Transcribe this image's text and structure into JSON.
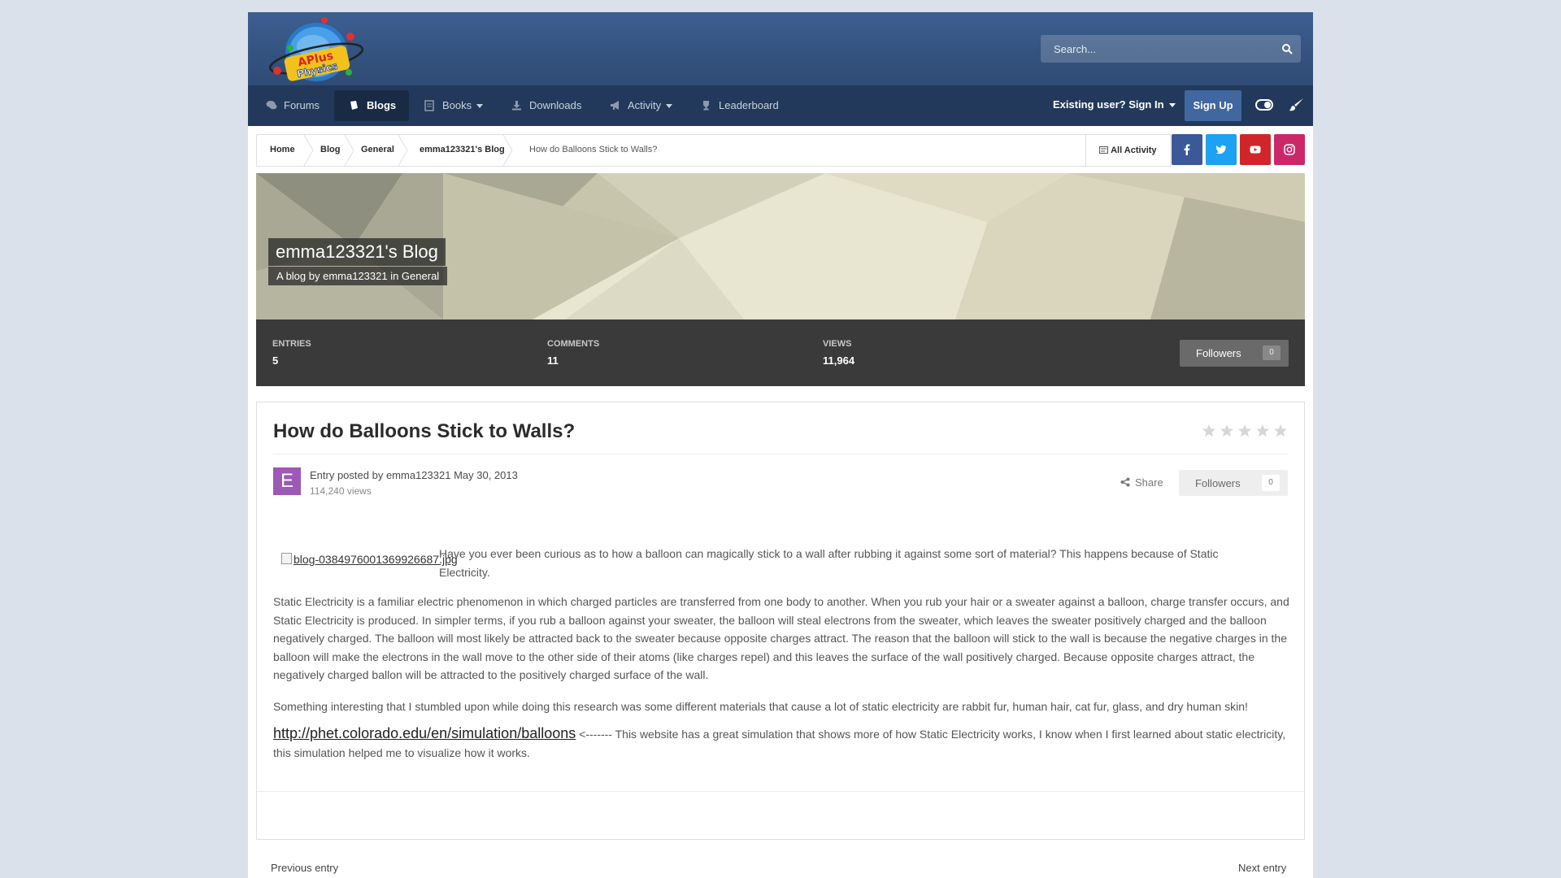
{
  "header": {
    "logo_text": [
      "APlus",
      "Physics"
    ],
    "search_placeholder": "Search..."
  },
  "nav": {
    "items": [
      {
        "label": "Forums",
        "icon": "comments-icon"
      },
      {
        "label": "Blogs",
        "icon": "book-icon",
        "active": true
      },
      {
        "label": "Books",
        "icon": "document-icon",
        "dropdown": true
      },
      {
        "label": "Downloads",
        "icon": "download-icon"
      },
      {
        "label": "Activity",
        "icon": "megaphone-icon",
        "dropdown": true
      },
      {
        "label": "Leaderboard",
        "icon": "trophy-icon"
      }
    ],
    "signin_label": "Existing user? Sign In",
    "signup_label": "Sign Up"
  },
  "breadcrumb": {
    "items": [
      "Home",
      "Blog",
      "General",
      "emma123321's Blog",
      "How do Balloons Stick to Walls?"
    ],
    "all_activity": "All Activity"
  },
  "social": [
    {
      "name": "facebook",
      "color": "#3b5998"
    },
    {
      "name": "twitter",
      "color": "#1da1f2"
    },
    {
      "name": "youtube",
      "color": "#d0262a"
    },
    {
      "name": "instagram",
      "color": "#cb2869"
    }
  ],
  "blog": {
    "title": "emma123321's Blog",
    "subtitle": "A blog by emma123321 in General",
    "stats": [
      {
        "label": "Entries",
        "value": "5"
      },
      {
        "label": "Comments",
        "value": "11"
      },
      {
        "label": "Views",
        "value": "11,964"
      }
    ],
    "followers_label": "Followers",
    "followers_count": "0"
  },
  "entry": {
    "title": "How do Balloons Stick to Walls?",
    "rating_stars": 0,
    "avatar_letter": "E",
    "avatar_color": "#9c59b6",
    "posted_prefix": "Entry posted by",
    "author": "emma123321",
    "date": "May 30, 2013",
    "views": "114,240 views",
    "share_label": "Share",
    "followers_label": "Followers",
    "followers_count": "0",
    "image_alt": "blog-0384976001369926687.jpg",
    "paragraphs": [
      "Have you ever been curious as to how a balloon can magically stick to a wall after rubbing it against some sort of material? This happens because of Static Electricity.",
      "Static Electricity is a familiar electric phenomenon in which charged particles are transferred from one body to another. When you rub your hair or a sweater against a balloon, charge transfer occurs, and Static Electricity is produced. In simpler terms, if you rub a balloon against your sweater, the balloon will steal electrons from the sweater, which leaves the sweater positively charged and the balloon negatively charged. The balloon will most likely be attracted back to the sweater because opposite charges attract. The reason that the balloon will stick to the wall is because the negative charges in the balloon will make the electrons in the wall move to the other side of their atoms (like charges repel) and this leaves the surface of the wall positively charged. Because opposite charges attract, the negatively charged ballon will be attracted to the positively charged surface of the wall.",
      "Something interesting that I stumbled upon while doing this research was some different materials that cause a lot of static electricity are rabbit fur, human hair, cat fur, glass, and dry human skin!"
    ],
    "link_url": "http://phet.colorado.edu/en/simulation/balloons",
    "link_tail": "<------- This website has a great simulation that shows more of how Static Electricity works, I know when I first learned about static electricity, this simulation helped me to visualize how it works."
  },
  "pager": {
    "prev": "Previous entry",
    "next": "Next entry"
  }
}
